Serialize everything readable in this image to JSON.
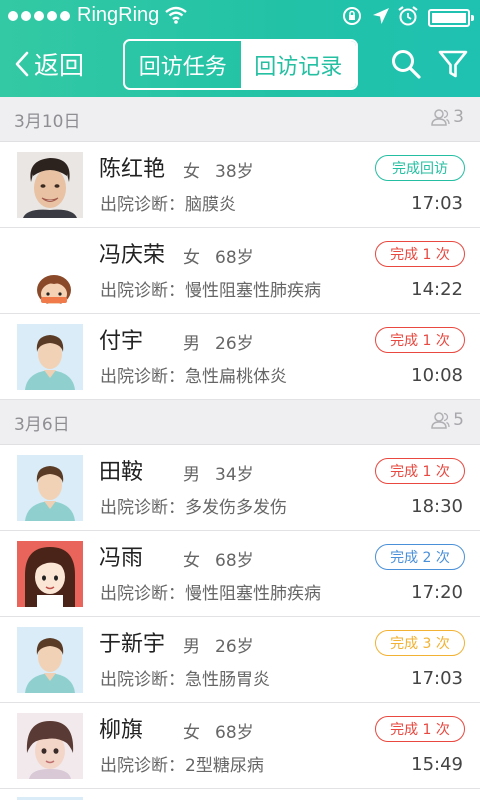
{
  "status_bar": {
    "carrier": "RingRing"
  },
  "nav": {
    "back_label": "返回",
    "tabs": [
      {
        "label": "回访任务",
        "active": true
      },
      {
        "label": "回访记录",
        "active": false
      }
    ],
    "search_icon": "search-icon",
    "filter_icon": "filter-icon"
  },
  "diag_prefix": "出院诊断:",
  "colors": {
    "teal": "#24bfa2",
    "red": "#e8483f",
    "blue": "#4a90d9",
    "amber": "#f2b233"
  },
  "sections": [
    {
      "date": "3月10日",
      "count": "3",
      "rows": [
        {
          "name": "陈红艳",
          "gender": "女",
          "age": "38岁",
          "diagnosis": "出院诊断：脑膜炎",
          "status": "完成回访",
          "status_color": "teal",
          "time": "17:03",
          "avatar": "photo-man"
        },
        {
          "name": "冯庆荣",
          "gender": "女",
          "age": "68岁",
          "diagnosis": "出院诊断：慢性阻塞性肺疾病",
          "status": "完成 1 次",
          "status_color": "red",
          "time": "14:22",
          "avatar": "cartoon-child"
        },
        {
          "name": "付宇",
          "gender": "男",
          "age": "26岁",
          "diagnosis": "出院诊断：急性扁桃体炎",
          "status": "完成 1 次",
          "status_color": "red",
          "time": "10:08",
          "avatar": "default-male"
        }
      ]
    },
    {
      "date": "3月6日",
      "count": "5",
      "rows": [
        {
          "name": "田鞍",
          "gender": "男",
          "age": "34岁",
          "diagnosis": "出院诊断：多发伤多发伤",
          "status": "完成 1 次",
          "status_color": "red",
          "time": "18:30",
          "avatar": "default-male"
        },
        {
          "name": "冯雨",
          "gender": "女",
          "age": "68岁",
          "diagnosis": "出院诊断：慢性阻塞性肺疾病",
          "status": "完成 2 次",
          "status_color": "blue",
          "time": "17:20",
          "avatar": "cartoon-girl"
        },
        {
          "name": "于新宇",
          "gender": "男",
          "age": "26岁",
          "diagnosis": "出院诊断：急性肠胃炎",
          "status": "完成 3 次",
          "status_color": "amber",
          "time": "17:03",
          "avatar": "default-male"
        },
        {
          "name": "柳旗",
          "gender": "女",
          "age": "68岁",
          "diagnosis": "出院诊断：2型糖尿病",
          "status": "完成 1 次",
          "status_color": "red",
          "time": "15:49",
          "avatar": "photo-child"
        }
      ]
    }
  ]
}
